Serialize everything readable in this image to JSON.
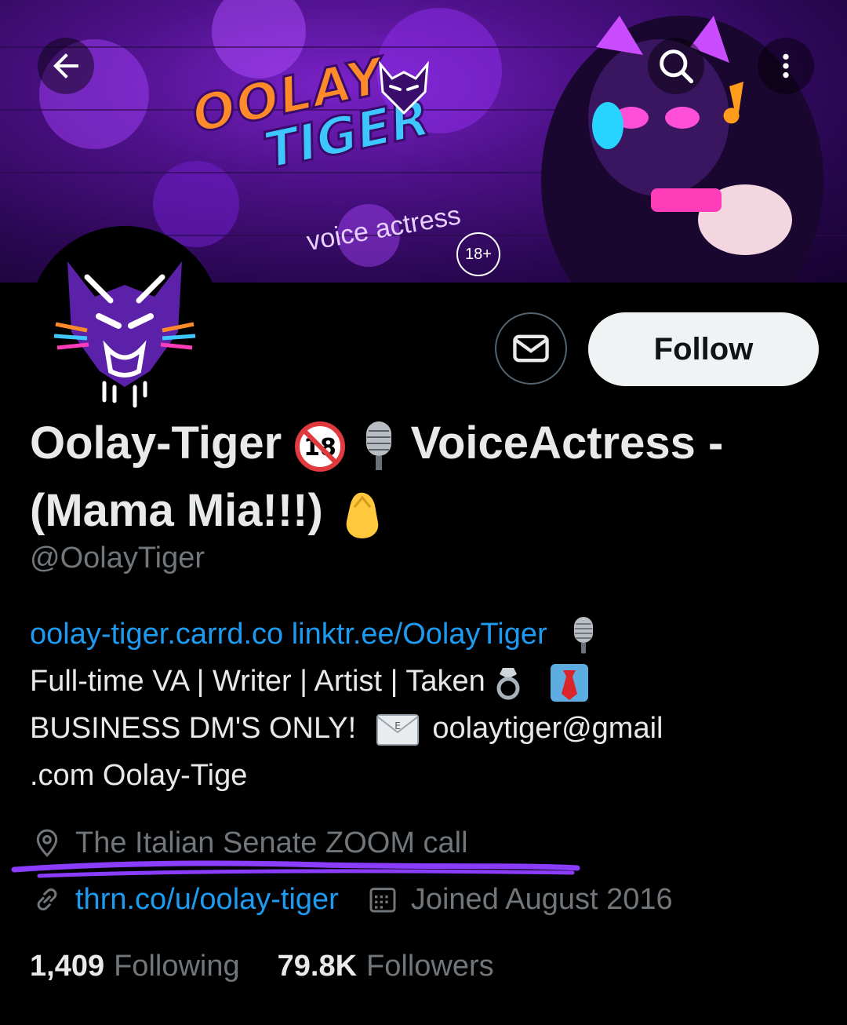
{
  "banner": {
    "logo_line1": "OOLAY",
    "logo_line2": "TIGER",
    "subtitle": "voice actress",
    "badge": "18+"
  },
  "header": {
    "back_icon": "arrow-left-icon",
    "search_icon": "search-icon",
    "more_icon": "more-vertical-icon"
  },
  "actions": {
    "message_icon": "envelope-icon",
    "follow_label": "Follow"
  },
  "profile": {
    "name_part1": "Oolay-Tiger",
    "name_part2": "VoiceActress -",
    "name_part3": "(Mama Mia!!!)",
    "handle": "@OolayTiger"
  },
  "bio": {
    "link1": "oolay-tiger.carrd.co",
    "link2": "linktr.ee/OolayTiger",
    "line2": "Full-time VA | Writer | Artist | Taken",
    "line3_text": "BUSINESS DM'S ONLY!",
    "line3_email": "oolaytiger@gmail",
    "line4": ".com Oolay-Tige"
  },
  "meta": {
    "location": "The Italian Senate ZOOM call",
    "website": "thrn.co/u/oolay-tiger",
    "joined": "Joined August 2016"
  },
  "stats": {
    "following_count": "1,409",
    "following_label": "Following",
    "followers_count": "79.8K",
    "followers_label": "Followers"
  },
  "colors": {
    "background": "#000000",
    "link": "#1d9bf0",
    "secondary_text": "#71767b",
    "annotation_underline": "#8a3cff"
  }
}
